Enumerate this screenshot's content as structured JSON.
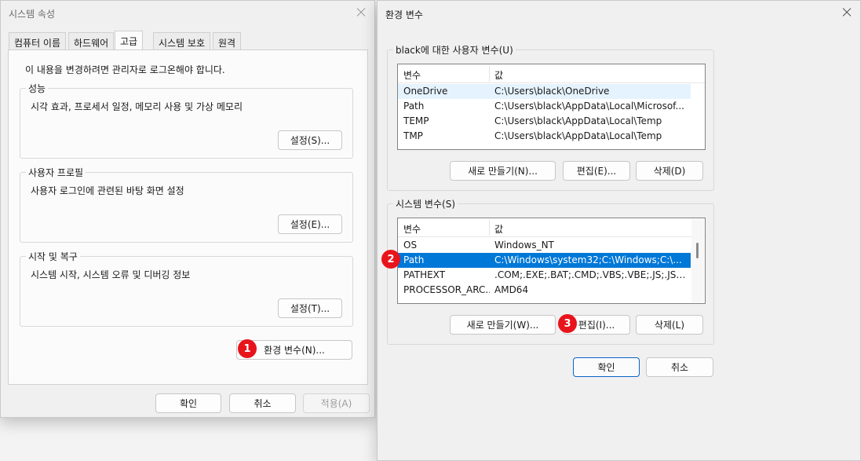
{
  "sys_props": {
    "title": "시스템 속성",
    "tabs": [
      "컴퓨터 이름",
      "하드웨어",
      "고급",
      "시스템 보호",
      "원격"
    ],
    "admin_note": "이 내용을 변경하려면 관리자로 로그온해야 합니다.",
    "performance": {
      "label": "성능",
      "desc": "시각 효과, 프로세서 일정, 메모리 사용 및 가상 메모리",
      "button": "설정(S)..."
    },
    "user_profile": {
      "label": "사용자 프로필",
      "desc": "사용자 로그인에 관련된 바탕 화면 설정",
      "button": "설정(E)..."
    },
    "startup": {
      "label": "시작 및 복구",
      "desc": "시스템 시작, 시스템 오류 및 디버깅 정보",
      "button": "설정(T)..."
    },
    "env_button": "환경 변수(N)...",
    "ok": "확인",
    "cancel": "취소",
    "apply": "적용(A)"
  },
  "env_vars": {
    "title": "환경 변수",
    "user_group_label": "black에 대한 사용자 변수(U)",
    "col_var": "변수",
    "col_val": "값",
    "user_rows": [
      {
        "name": "OneDrive",
        "value": "C:\\Users\\black\\OneDrive"
      },
      {
        "name": "Path",
        "value": "C:\\Users\\black\\AppData\\Local\\Microsof..."
      },
      {
        "name": "TEMP",
        "value": "C:\\Users\\black\\AppData\\Local\\Temp"
      },
      {
        "name": "TMP",
        "value": "C:\\Users\\black\\AppData\\Local\\Temp"
      }
    ],
    "user_buttons": {
      "new": "새로 만들기(N)...",
      "edit": "편집(E)...",
      "delete": "삭제(D)"
    },
    "system_group_label": "시스템 변수(S)",
    "system_rows": [
      {
        "name": "OS",
        "value": "Windows_NT"
      },
      {
        "name": "Path",
        "value": "C:\\Windows\\system32;C:\\Windows;C:\\..."
      },
      {
        "name": "PATHEXT",
        "value": ".COM;.EXE;.BAT;.CMD;.VBS;.VBE;.JS;.JSE;.W..."
      },
      {
        "name": "PROCESSOR_ARC...",
        "value": "AMD64"
      }
    ],
    "system_buttons": {
      "new": "새로 만들기(W)...",
      "edit": "편집(I)...",
      "delete": "삭제(L)"
    },
    "ok": "확인",
    "cancel": "취소"
  },
  "badges": [
    "1",
    "2",
    "3"
  ],
  "colors": {
    "selection": "#0078d7",
    "badge": "#e8141c",
    "primary_border": "#0a64c8"
  }
}
